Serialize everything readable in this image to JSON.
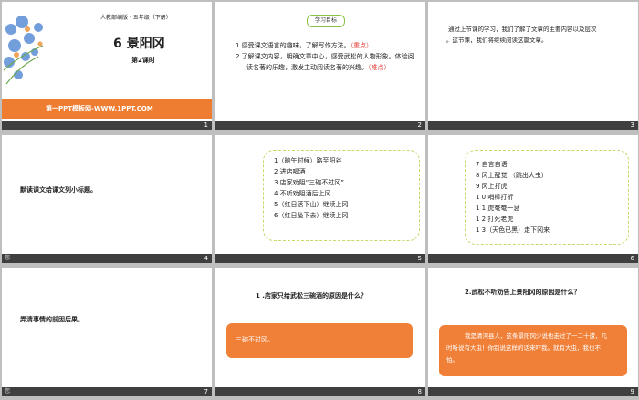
{
  "slides": [
    {
      "num": "1",
      "publisher": "人教部编版 · 五年级（下册）",
      "title": "6 景阳冈",
      "subtitle": "第2课时",
      "footer_link": "第一PPT模板网-WWW.1PPT.COM"
    },
    {
      "num": "2",
      "heading": "学习目标",
      "goals": [
        {
          "text": "1.感受课文语言的趣味，了解写作方法。",
          "mark": "（重点）"
        },
        {
          "text": "2.了解课文内容，明确文章中心，感受武松的人物形象。体验阅",
          "mark": ""
        },
        {
          "text": "读名著的乐趣，激发主动阅读名著的兴趣。",
          "mark": "（难点）"
        }
      ]
    },
    {
      "num": "3",
      "lines": [
        "通过上节课的学习，我们了解了文章的主要内容以及层次",
        "。这节课，我们将继续阅读这篇文章。"
      ]
    },
    {
      "num": "4",
      "label": "默读课文给课文列小标题。"
    },
    {
      "num": "5",
      "items": [
        "1（晌午时候）路至阳谷",
        "2 进店喝酒",
        "3 店家劝阻“三碗不过冈”",
        "4 不听劝阻酒后上冈",
        "5（红日落下山）继续上冈",
        "6（红日坠下去）继续上冈"
      ]
    },
    {
      "num": "6",
      "items": [
        "7 自言自语",
        "8 冈上醒觉 （跳出大虫）",
        "9 冈上打虎",
        "1 0 哨棒打折",
        "1 1 虎奄奄一息",
        "1 2 打死老虎",
        "1 3（天色已黑）走下冈来"
      ]
    },
    {
      "num": "7",
      "label": "弄清事情的前因后果。"
    },
    {
      "num": "8",
      "question": "1 .店家只给武松三碗酒的原因是什么？",
      "answer": "三碗不过冈。"
    },
    {
      "num": "9",
      "question": "2.武松不听劝告上景阳冈的原因是什么？",
      "answer_lines": [
        "我是清河县人，这条景阳冈少说也走过了一二十遭，几",
        "时听说有大虫！你别说这样的话来吓我。就有大虫，我也不",
        "怕。"
      ]
    }
  ],
  "bar_left_label": "您"
}
